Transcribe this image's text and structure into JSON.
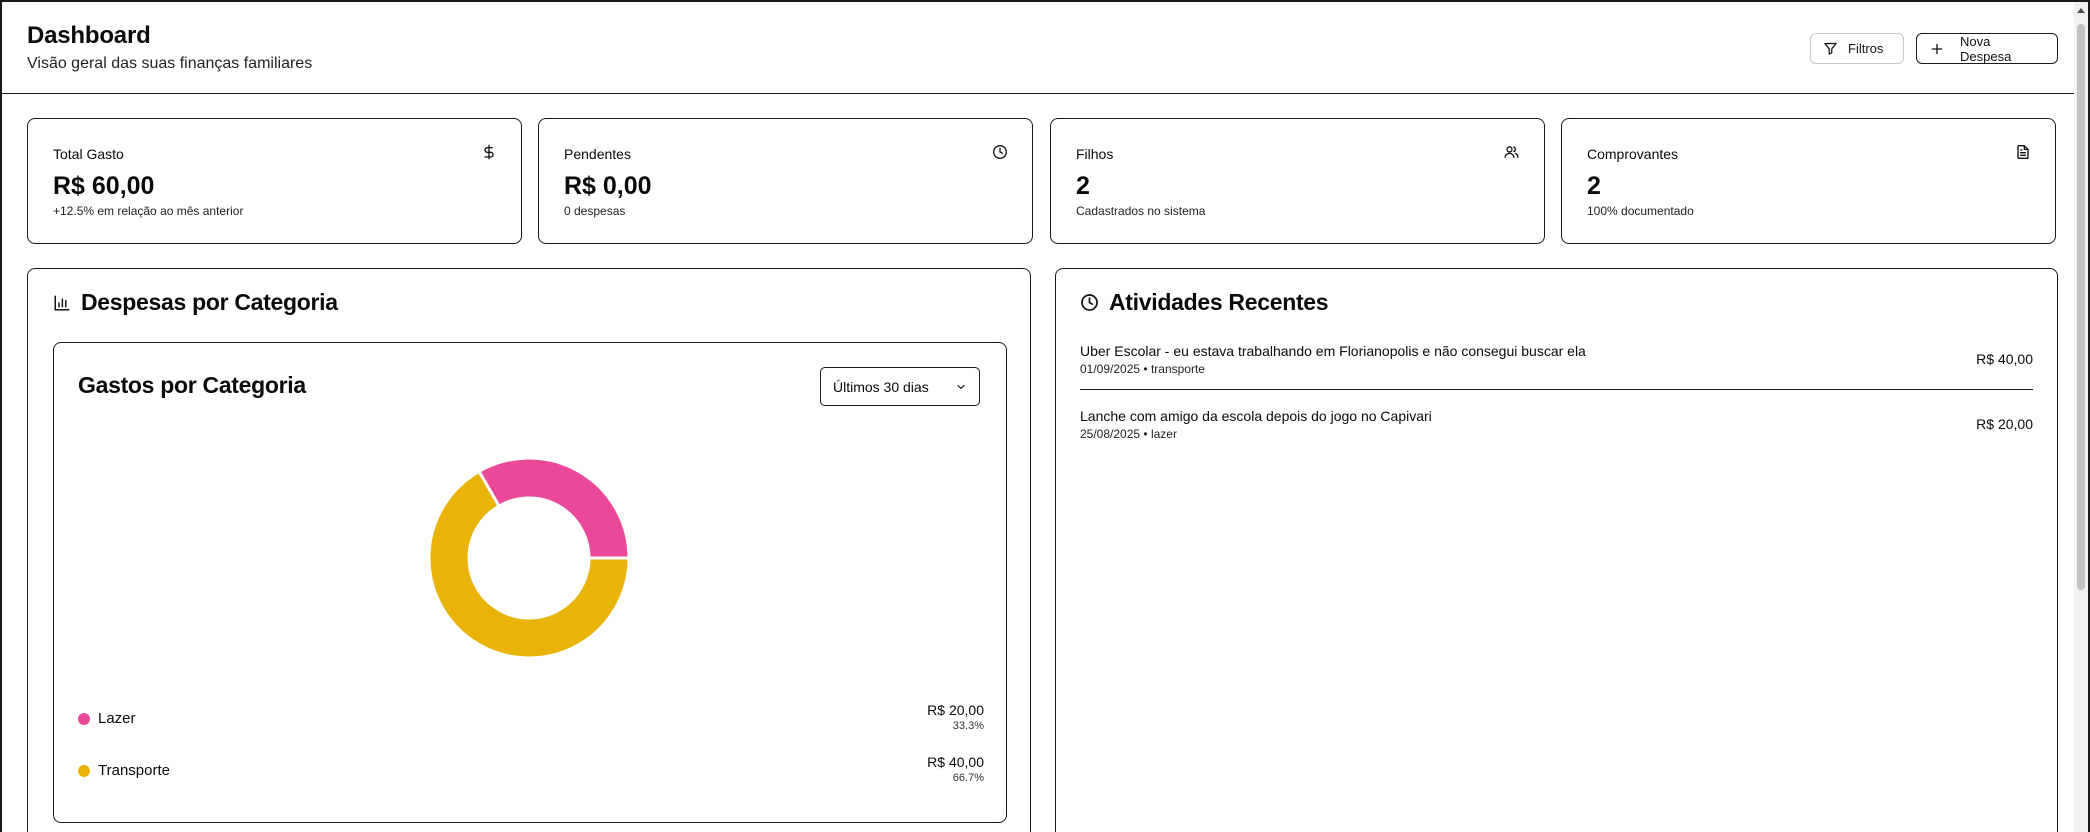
{
  "header": {
    "title": "Dashboard",
    "subtitle": "Visão geral das suas finanças familiares",
    "filters_label": "Filtros",
    "new_expense_label": "Nova Despesa"
  },
  "stats": [
    {
      "label": "Total Gasto",
      "value": "R$ 60,00",
      "sub": "+12.5% em relação ao mês anterior",
      "icon": "dollar-icon"
    },
    {
      "label": "Pendentes",
      "value": "R$ 0,00",
      "sub": "0 despesas",
      "icon": "clock-icon"
    },
    {
      "label": "Filhos",
      "value": "2",
      "sub": "Cadastrados no sistema",
      "icon": "users-icon"
    },
    {
      "label": "Comprovantes",
      "value": "2",
      "sub": "100% documentado",
      "icon": "file-text-icon"
    }
  ],
  "category_panel": {
    "title": "Despesas por Categoria",
    "chart_title": "Gastos por Categoria",
    "period_selected": "Últimos 30 dias"
  },
  "chart_data": {
    "type": "pie",
    "title": "Gastos por Categoria",
    "categories": [
      "Lazer",
      "Transporte"
    ],
    "values": [
      20,
      40
    ],
    "amounts": [
      "R$ 20,00",
      "R$ 40,00"
    ],
    "percents": [
      "33.3%",
      "66.7%"
    ],
    "colors": [
      "#ec4899",
      "#eab308"
    ],
    "donut": true
  },
  "activity_panel": {
    "title": "Atividades Recentes",
    "items": [
      {
        "title": "Uber Escolar - eu estava trabalhando em Florianopolis e não consegui buscar ela",
        "date": "01/09/2025",
        "category": "transporte",
        "amount": "R$ 40,00"
      },
      {
        "title": "Lanche com amigo da escola depois do jogo no Capivari",
        "date": "25/08/2025",
        "category": "lazer",
        "amount": "R$ 20,00"
      }
    ]
  },
  "colors": {
    "border": "#1a1a1a",
    "lazer": "#ec4899",
    "transporte": "#eab308"
  }
}
